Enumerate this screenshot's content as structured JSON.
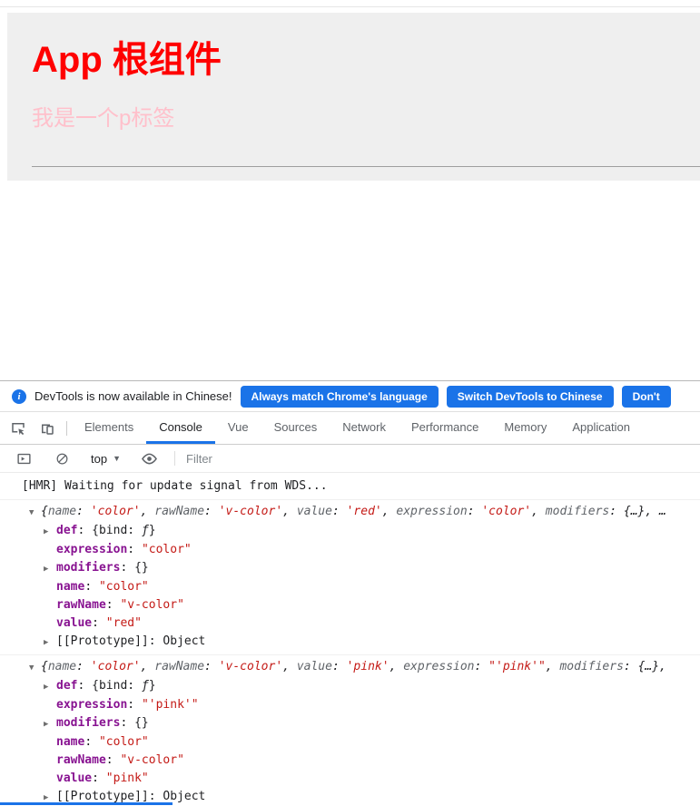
{
  "app_page": {
    "heading": "App 根组件",
    "paragraph": "我是一个p标签",
    "heading_color": "#ff0000",
    "paragraph_color": "#ffc0cb"
  },
  "devtools": {
    "language_infobar": {
      "message": "DevTools is now available in Chinese!",
      "buttons": [
        "Always match Chrome's language",
        "Switch DevTools to Chinese",
        "Don't"
      ],
      "accent_color": "#1a73e8"
    },
    "tab_bar": {
      "tabs": [
        {
          "label": "Elements",
          "selected": false
        },
        {
          "label": "Console",
          "selected": true
        },
        {
          "label": "Vue",
          "selected": false
        },
        {
          "label": "Sources",
          "selected": false
        },
        {
          "label": "Network",
          "selected": false
        },
        {
          "label": "Performance",
          "selected": false
        },
        {
          "label": "Memory",
          "selected": false
        },
        {
          "label": "Application",
          "selected": false
        }
      ]
    },
    "console_toolbar": {
      "context_selector": "top",
      "filter_placeholder": "Filter"
    },
    "console": {
      "hmr_message": "[HMR] Waiting for update signal from WDS...",
      "objects": [
        {
          "preview_segments": [
            {
              "type": "punct",
              "text": "{"
            },
            {
              "type": "key",
              "text": "name"
            },
            {
              "type": "punct",
              "text": ": "
            },
            {
              "type": "string",
              "text": "'color'"
            },
            {
              "type": "punct",
              "text": ", "
            },
            {
              "type": "key",
              "text": "rawName"
            },
            {
              "type": "punct",
              "text": ": "
            },
            {
              "type": "string",
              "text": "'v-color'"
            },
            {
              "type": "punct",
              "text": ", "
            },
            {
              "type": "key",
              "text": "value"
            },
            {
              "type": "punct",
              "text": ": "
            },
            {
              "type": "string",
              "text": "'red'"
            },
            {
              "type": "punct",
              "text": ", "
            },
            {
              "type": "key",
              "text": "expression"
            },
            {
              "type": "punct",
              "text": ": "
            },
            {
              "type": "string",
              "text": "'color'"
            },
            {
              "type": "punct",
              "text": ", "
            },
            {
              "type": "key",
              "text": "modifiers"
            },
            {
              "type": "punct",
              "text": ": "
            },
            {
              "type": "object",
              "text": "{…}"
            },
            {
              "type": "punct",
              "text": ", …"
            }
          ],
          "properties": [
            {
              "expandable": true,
              "key": "def",
              "key_style": "normal",
              "value": "{bind: ƒ}",
              "value_style": "object"
            },
            {
              "expandable": false,
              "key": "expression",
              "key_style": "normal",
              "value": "\"color\"",
              "value_style": "string"
            },
            {
              "expandable": true,
              "key": "modifiers",
              "key_style": "normal",
              "value": "{}",
              "value_style": "object"
            },
            {
              "expandable": false,
              "key": "name",
              "key_style": "normal",
              "value": "\"color\"",
              "value_style": "string"
            },
            {
              "expandable": false,
              "key": "rawName",
              "key_style": "normal",
              "value": "\"v-color\"",
              "value_style": "string"
            },
            {
              "expandable": false,
              "key": "value",
              "key_style": "normal",
              "value": "\"red\"",
              "value_style": "string"
            },
            {
              "expandable": true,
              "key": "[[Prototype]]",
              "key_style": "internal",
              "value": "Object",
              "value_style": "object"
            }
          ]
        },
        {
          "preview_segments": [
            {
              "type": "punct",
              "text": "{"
            },
            {
              "type": "key",
              "text": "name"
            },
            {
              "type": "punct",
              "text": ": "
            },
            {
              "type": "string",
              "text": "'color'"
            },
            {
              "type": "punct",
              "text": ", "
            },
            {
              "type": "key",
              "text": "rawName"
            },
            {
              "type": "punct",
              "text": ": "
            },
            {
              "type": "string",
              "text": "'v-color'"
            },
            {
              "type": "punct",
              "text": ", "
            },
            {
              "type": "key",
              "text": "value"
            },
            {
              "type": "punct",
              "text": ": "
            },
            {
              "type": "string",
              "text": "'pink'"
            },
            {
              "type": "punct",
              "text": ", "
            },
            {
              "type": "key",
              "text": "expression"
            },
            {
              "type": "punct",
              "text": ": "
            },
            {
              "type": "string",
              "text": "\"'pink'\""
            },
            {
              "type": "punct",
              "text": ", "
            },
            {
              "type": "key",
              "text": "modifiers"
            },
            {
              "type": "punct",
              "text": ": "
            },
            {
              "type": "object",
              "text": "{…}"
            },
            {
              "type": "punct",
              "text": ","
            }
          ],
          "properties": [
            {
              "expandable": true,
              "key": "def",
              "key_style": "normal",
              "value": "{bind: ƒ}",
              "value_style": "object"
            },
            {
              "expandable": false,
              "key": "expression",
              "key_style": "normal",
              "value": "\"'pink'\"",
              "value_style": "string"
            },
            {
              "expandable": true,
              "key": "modifiers",
              "key_style": "normal",
              "value": "{}",
              "value_style": "object"
            },
            {
              "expandable": false,
              "key": "name",
              "key_style": "normal",
              "value": "\"color\"",
              "value_style": "string"
            },
            {
              "expandable": false,
              "key": "rawName",
              "key_style": "normal",
              "value": "\"v-color\"",
              "value_style": "string"
            },
            {
              "expandable": false,
              "key": "value",
              "key_style": "normal",
              "value": "\"pink\"",
              "value_style": "string"
            },
            {
              "expandable": true,
              "key": "[[Prototype]]",
              "key_style": "internal",
              "value": "Object",
              "value_style": "object"
            }
          ]
        }
      ]
    }
  }
}
